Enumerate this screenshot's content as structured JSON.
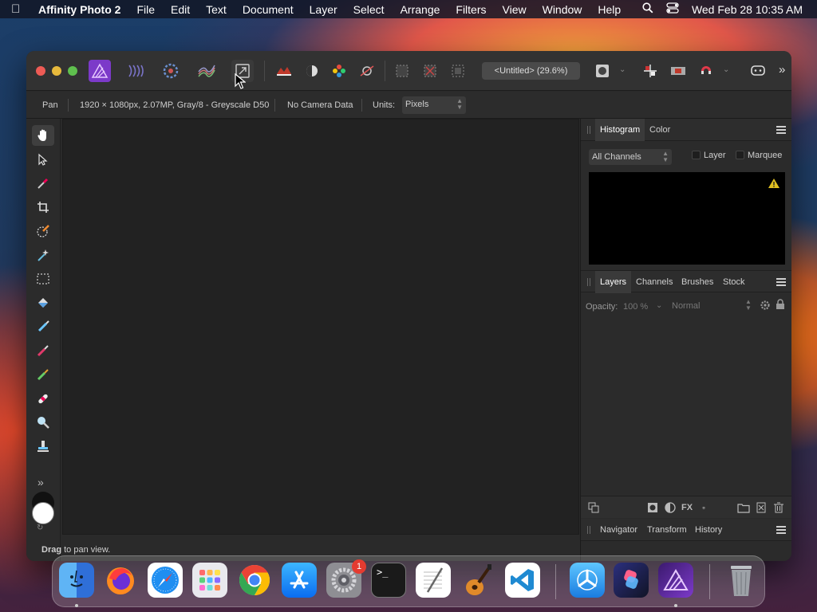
{
  "menubar": {
    "app_name": "Affinity Photo 2",
    "menus": [
      "File",
      "Edit",
      "Text",
      "Document",
      "Layer",
      "Select",
      "Arrange",
      "Filters",
      "View",
      "Window",
      "Help"
    ],
    "clock": "Wed Feb 28  10:35 AM"
  },
  "toolbar": {
    "document_title": "<Untitled> (29.6%)"
  },
  "context": {
    "tool_name": "Pan",
    "doc_info": "1920 × 1080px, 2.07MP, Gray/8 - Greyscale D50",
    "camera": "No Camera Data",
    "units_label": "Units:",
    "units_value": "Pixels"
  },
  "histogram_panel": {
    "tabs": [
      "Histogram",
      "Color"
    ],
    "channel": "All Channels",
    "layer_label": "Layer",
    "marquee_label": "Marquee"
  },
  "layers_panel": {
    "tabs": [
      "Layers",
      "Channels",
      "Brushes",
      "Stock"
    ],
    "opacity_label": "Opacity:",
    "opacity_value": "100 %",
    "blend_mode": "Normal"
  },
  "bottom_panel": {
    "tabs": [
      "Navigator",
      "Transform",
      "History"
    ]
  },
  "status": {
    "bold": "Drag",
    "rest": " to pan view."
  },
  "dock": {
    "settings_badge": "1"
  },
  "colors": {
    "affinity_purple": "#7c3ac9",
    "warning": "#e0c020",
    "badge_red": "#e53b30"
  }
}
